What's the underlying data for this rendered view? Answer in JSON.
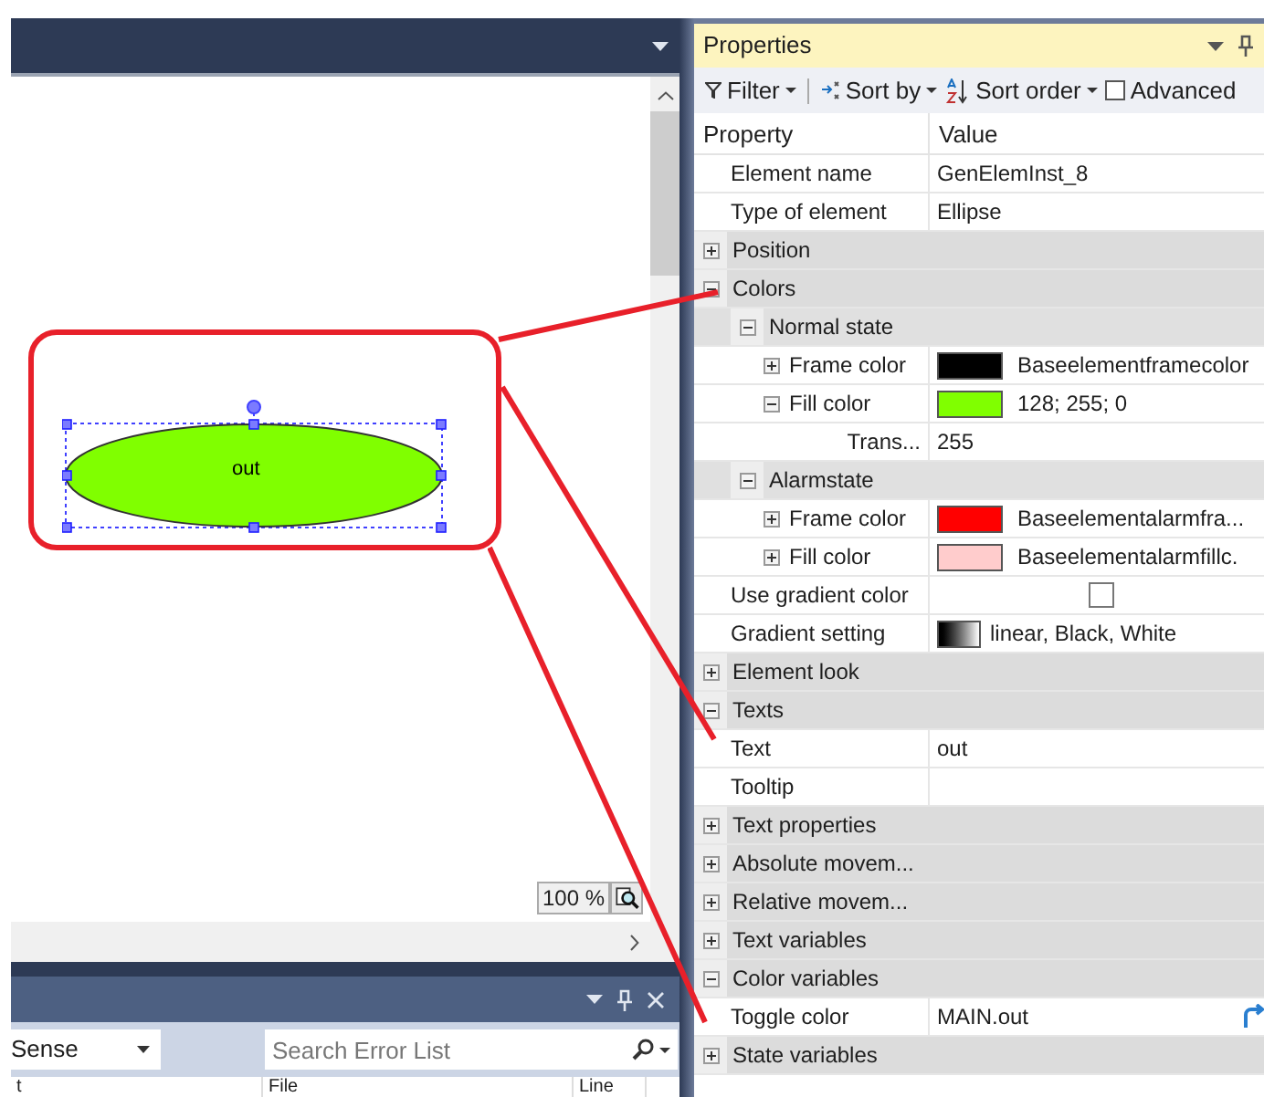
{
  "designer": {
    "element": {
      "text": "out",
      "color": "#80ff00",
      "selected": true
    },
    "zoom": "100 %"
  },
  "error_list": {
    "filter_dropdown": "Sense",
    "search": {
      "placeholder": "Search Error List"
    },
    "columns": [
      "t",
      "File",
      "Line"
    ]
  },
  "properties": {
    "title": "Properties",
    "toolbar": [
      {
        "kind": "dropdown",
        "label": "Filter"
      },
      {
        "kind": "dropdown",
        "label": "Sort by"
      },
      {
        "kind": "dropdown",
        "label": "Sort order"
      },
      {
        "kind": "checkbox",
        "label": "Advanced",
        "checked": false
      }
    ],
    "columns": [
      "Property",
      "Value"
    ],
    "rows": [
      {
        "kind": "text",
        "name": "Element name",
        "value": "GenElemInst_8"
      },
      {
        "kind": "text",
        "name": "Type of element",
        "value": "Ellipse"
      },
      {
        "kind": "category",
        "name": "Position",
        "expanded": false
      },
      {
        "kind": "category",
        "name": "Colors",
        "expanded": true,
        "children": [
          {
            "kind": "group",
            "name": "Normal state",
            "expanded": true,
            "children": [
              {
                "kind": "color",
                "name": "Frame color",
                "expanded": false,
                "color": "#000000",
                "value": "Baseelementframecolor"
              },
              {
                "kind": "color",
                "name": "Fill color",
                "expanded": true,
                "color": "#80ff00",
                "value": "128; 255; 0",
                "children": [
                  {
                    "kind": "text",
                    "name": "Trans...",
                    "value": "255"
                  }
                ]
              }
            ]
          },
          {
            "kind": "group",
            "name": "Alarmstate",
            "expanded": true,
            "children": [
              {
                "kind": "color",
                "name": "Frame color",
                "expanded": false,
                "color": "#ff0000",
                "value": "Baseelementalarmfra..."
              },
              {
                "kind": "color",
                "name": "Fill color",
                "expanded": false,
                "color": "#ffcccc",
                "value": "Baseelementalarmfillc."
              }
            ]
          },
          {
            "kind": "checkbox",
            "name": "Use gradient color",
            "checked": false
          },
          {
            "kind": "gradient",
            "name": "Gradient setting",
            "value": "linear, Black, White"
          }
        ]
      },
      {
        "kind": "category",
        "name": "Element look",
        "expanded": false
      },
      {
        "kind": "category",
        "name": "Texts",
        "expanded": true,
        "children": [
          {
            "kind": "text",
            "name": "Text",
            "value": "out"
          },
          {
            "kind": "text",
            "name": "Tooltip"
          }
        ]
      },
      {
        "kind": "category",
        "name": "Text properties",
        "expanded": false
      },
      {
        "kind": "category",
        "name": "Absolute movem...",
        "expanded": false
      },
      {
        "kind": "category",
        "name": "Relative movem...",
        "expanded": false
      },
      {
        "kind": "category",
        "name": "Text variables",
        "expanded": false
      },
      {
        "kind": "category",
        "name": "Color variables",
        "expanded": true,
        "children": [
          {
            "kind": "variable",
            "name": "Toggle color",
            "value": "MAIN.out"
          }
        ]
      },
      {
        "kind": "category",
        "name": "State variables",
        "expanded": false
      }
    ]
  }
}
